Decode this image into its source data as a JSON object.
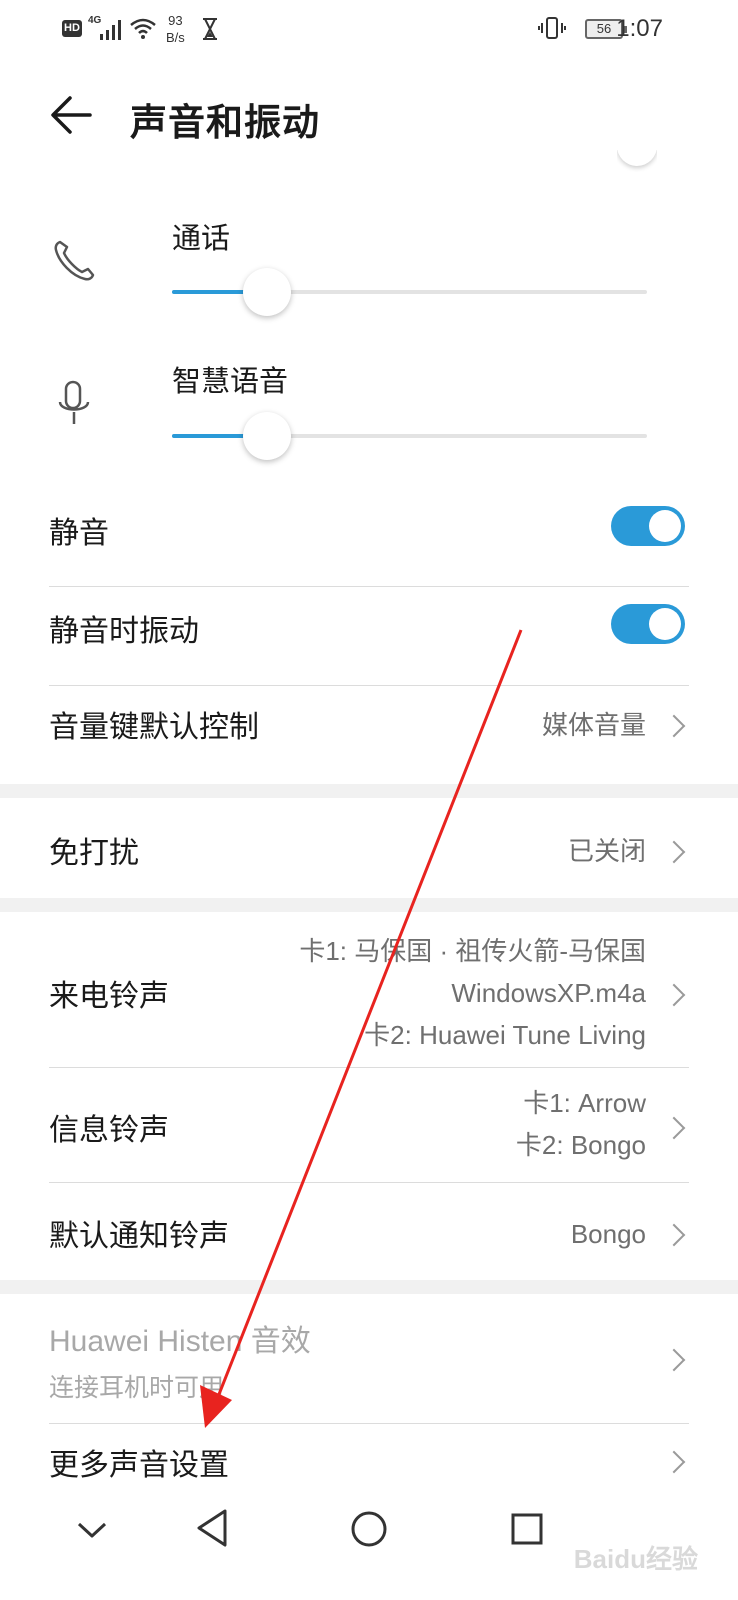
{
  "status_bar": {
    "hd": "HD",
    "network": "4G",
    "speed_value": "93",
    "speed_unit": "B/s",
    "battery": "56",
    "time": "1:07"
  },
  "header": {
    "title": "声音和振动"
  },
  "sliders": [
    {
      "label": "通话",
      "icon": "phone-icon",
      "level_percent": 20
    },
    {
      "label": "智慧语音",
      "icon": "microphone-icon",
      "level_percent": 20
    }
  ],
  "settings": {
    "mute": {
      "label": "静音",
      "on": true
    },
    "vibrate_on_mute": {
      "label": "静音时振动",
      "on": true
    },
    "volume_key": {
      "label": "音量键默认控制",
      "value": "媒体音量"
    },
    "dnd": {
      "label": "免打扰",
      "value": "已关闭"
    },
    "ringtone": {
      "label": "来电铃声",
      "value_line1": "卡1: 马保国 · 祖传火箭-马保国",
      "value_line2": "WindowsXP.m4a",
      "value_line3": "卡2: Huawei Tune Living"
    },
    "message_tone": {
      "label": "信息铃声",
      "value_line1": "卡1: Arrow",
      "value_line2": "卡2: Bongo"
    },
    "notification_tone": {
      "label": "默认通知铃声",
      "value": "Bongo"
    },
    "histen": {
      "label": "Huawei Histen 音效",
      "subtitle": "连接耳机时可用"
    },
    "more": {
      "label": "更多声音设置"
    }
  },
  "watermark": "Baidu经验",
  "colors": {
    "accent": "#2a9ad8",
    "annotation_arrow": "#e8231f"
  }
}
